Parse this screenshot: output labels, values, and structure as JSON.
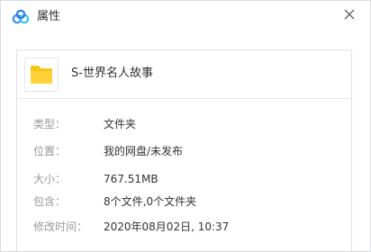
{
  "window": {
    "title": "属性",
    "app_icon": "baidu-netdisk-logo-icon",
    "close_icon": "close-icon"
  },
  "item": {
    "icon": "folder-icon",
    "name": "S-世界名人故事"
  },
  "properties": [
    {
      "label": "类型：",
      "value": "文件夹"
    },
    {
      "label": "位置：",
      "value": "我的网盘/未发布"
    },
    {
      "label": "大小：",
      "value": "767.51MB"
    },
    {
      "label": "包含：",
      "value": "8个文件,0个文件夹"
    },
    {
      "label": "修改时间：",
      "value": "2020年08月02日, 10:37"
    }
  ],
  "colors": {
    "folder": "#f5c518",
    "logo_blue": "#3c8ef0",
    "logo_cyan": "#33c3f0",
    "label_text": "#999999",
    "value_text": "#333333"
  }
}
